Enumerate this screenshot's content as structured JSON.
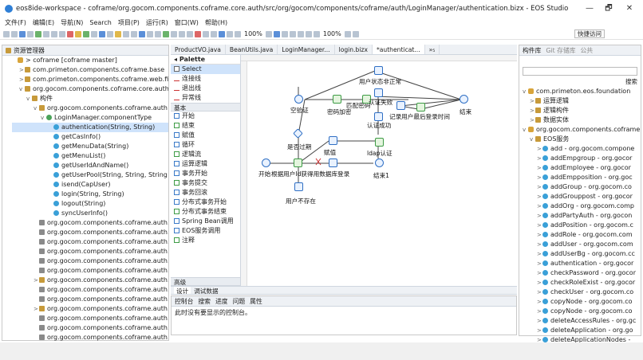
{
  "window": {
    "title": "eos8ide-workspace - coframe/org.gocom.components.coframe.core.auth/src/org/gocom/components/coframe/auth/LoginManager/authentication.bizx - EOS Studio",
    "minimize": "—",
    "maximize": "🗗",
    "close": "✕"
  },
  "menu": [
    "文件(F)",
    "编辑(E)",
    "导航(N)",
    "Search",
    "项目(P)",
    "运行(R)",
    "窗口(W)",
    "帮助(H)"
  ],
  "toolbar": {
    "zoom1": "100%",
    "zoom2": "100%",
    "quick_access": "快捷访问"
  },
  "explorer": {
    "tab": "资源管理器",
    "rows": [
      {
        "indent": 0,
        "tw": "",
        "icon": "prj",
        "text": "> coframe [coframe master]"
      },
      {
        "indent": 1,
        "tw": ">",
        "icon": "pkg",
        "text": "com.primeton.components.coframe.base"
      },
      {
        "indent": 1,
        "tw": ">",
        "icon": "pkg",
        "text": "com.primeton.components.coframe.web.file"
      },
      {
        "indent": 1,
        "tw": "v",
        "icon": "pkg",
        "text": "org.gocom.components.coframe.core.auth"
      },
      {
        "indent": 2,
        "tw": "v",
        "icon": "pkg",
        "text": "构件"
      },
      {
        "indent": 3,
        "tw": "v",
        "icon": "pkg",
        "text": "org.gocom.components.coframe.auth"
      },
      {
        "indent": 4,
        "tw": "v",
        "icon": "cls",
        "text": "LoginManager.componentType"
      },
      {
        "indent": 5,
        "tw": "",
        "icon": "mth",
        "text": "authentication(String, String)",
        "sel": true
      },
      {
        "indent": 5,
        "tw": "",
        "icon": "mth",
        "text": "getCasInfo()"
      },
      {
        "indent": 5,
        "tw": "",
        "icon": "mth",
        "text": "getMenuData(String)"
      },
      {
        "indent": 5,
        "tw": "",
        "icon": "mth",
        "text": "getMenuList()"
      },
      {
        "indent": 5,
        "tw": "",
        "icon": "mth",
        "text": "getUserIdAndName()"
      },
      {
        "indent": 5,
        "tw": "",
        "icon": "mth",
        "text": "getUserPool(String, String, String"
      },
      {
        "indent": 5,
        "tw": "",
        "icon": "mth",
        "text": "isend(CapUser)"
      },
      {
        "indent": 5,
        "tw": "",
        "icon": "mth",
        "text": "login(String, String)"
      },
      {
        "indent": 5,
        "tw": "",
        "icon": "mth",
        "text": "logout(String)"
      },
      {
        "indent": 5,
        "tw": "",
        "icon": "mth",
        "text": "syncUserInfo()"
      },
      {
        "indent": 3,
        "tw": "",
        "icon": "fld",
        "text": "org.gocom.components.coframe.auth.i"
      },
      {
        "indent": 3,
        "tw": "",
        "icon": "fld",
        "text": "org.gocom.components.coframe.auth.i"
      },
      {
        "indent": 3,
        "tw": "",
        "icon": "fld",
        "text": "org.gocom.components.coframe.auth.l"
      },
      {
        "indent": 3,
        "tw": "",
        "icon": "fld",
        "text": "org.gocom.components.coframe.auth.l"
      },
      {
        "indent": 3,
        "tw": "",
        "icon": "fld",
        "text": "org.gocom.components.coframe.auth.l"
      },
      {
        "indent": 3,
        "tw": "",
        "icon": "fld",
        "text": "org.gocom.components.coframe.auth.l"
      },
      {
        "indent": 3,
        "tw": ">",
        "icon": "pkg",
        "text": "org.gocom.components.coframe.auth.p"
      },
      {
        "indent": 3,
        "tw": "",
        "icon": "fld",
        "text": "org.gocom.components.coframe.auth.p"
      },
      {
        "indent": 3,
        "tw": "",
        "icon": "fld",
        "text": "org.gocom.components.coframe.auth.p"
      },
      {
        "indent": 3,
        "tw": ">",
        "icon": "pkg",
        "text": "org.gocom.components.coframe.auth.r"
      },
      {
        "indent": 3,
        "tw": "",
        "icon": "fld",
        "text": "org.gocom.components.coframe.auth.r"
      },
      {
        "indent": 3,
        "tw": "",
        "icon": "fld",
        "text": "org.gocom.components.coframe.auth.s"
      },
      {
        "indent": 3,
        "tw": "",
        "icon": "fld",
        "text": "org.gocom.components.coframe.auth.s"
      }
    ]
  },
  "editor": {
    "tabs": [
      "ProductVO.java",
      "BeanUtils.java",
      "LoginManager...",
      "login.bizx",
      "*authenticat...",
      "»₅"
    ],
    "active_tab": 4,
    "palette": {
      "title": "Palette",
      "select": "Select",
      "links": [
        "连接线",
        "退出线",
        "异常线"
      ],
      "group": "基本",
      "items": [
        "开始",
        "结束",
        "赋值",
        "循环",
        "逻辑流",
        "运算逻辑",
        "事务开始",
        "事务提交",
        "事务回滚",
        "分布式事务开始",
        "分布式事务结束",
        "Spring Bean调用",
        "EOS服务调用",
        "注释"
      ],
      "advanced": "高级"
    },
    "nodes": {
      "n_status": "用户状态非正常",
      "n_empty": "空验证",
      "n_pwd": "密码加密",
      "n_match": "匹配密码",
      "n_authfail": "认证失败",
      "n_record": "记录用户最后登录时间",
      "n_end": "结束",
      "n_authok": "认证成功",
      "n_expired": "是否过期",
      "n_assign": "赋值",
      "n_ldap": "ldap认证",
      "n_start": "开始",
      "n_query": "根据用户Id获得用数据库登录",
      "n_end1": "结束1",
      "n_nouser": "用户不存在"
    },
    "bottom_tabs": [
      "设计",
      "调试数据"
    ]
  },
  "console": {
    "tabs": [
      "控制台",
      "搜索",
      "进度",
      "问题",
      "属性"
    ],
    "message": "此时没有要显示的控制台。"
  },
  "right": {
    "tabs": [
      "构件库",
      "Git 存储库",
      "公共"
    ],
    "search_btn": "搜索",
    "rows": [
      {
        "indent": 0,
        "tw": "v",
        "icon": "prj",
        "text": "com.primeton.eos.foundation"
      },
      {
        "indent": 1,
        "tw": ">",
        "icon": "pkg",
        "text": "运算逻辑"
      },
      {
        "indent": 1,
        "tw": ">",
        "icon": "pkg",
        "text": "逻辑构件"
      },
      {
        "indent": 1,
        "tw": ">",
        "icon": "pkg",
        "text": "数据实体"
      },
      {
        "indent": 0,
        "tw": "v",
        "icon": "prj",
        "text": "org.gocom.components.coframe"
      },
      {
        "indent": 1,
        "tw": "v",
        "icon": "pkg",
        "text": "EOS服务"
      },
      {
        "indent": 2,
        "tw": ">",
        "icon": "mth",
        "text": "add - org.gocom.compone"
      },
      {
        "indent": 2,
        "tw": ">",
        "icon": "mth",
        "text": "addEmpgroup - org.gocor"
      },
      {
        "indent": 2,
        "tw": ">",
        "icon": "mth",
        "text": "addEmployee - org.gocor"
      },
      {
        "indent": 2,
        "tw": ">",
        "icon": "mth",
        "text": "addEmpposition - org.goc"
      },
      {
        "indent": 2,
        "tw": ">",
        "icon": "mth",
        "text": "addGroup - org.gocom.co"
      },
      {
        "indent": 2,
        "tw": ">",
        "icon": "mth",
        "text": "addGrouppost - org.gocor"
      },
      {
        "indent": 2,
        "tw": ">",
        "icon": "mth",
        "text": "addOrg - org.gocom.comp"
      },
      {
        "indent": 2,
        "tw": ">",
        "icon": "mth",
        "text": "addPartyAuth - org.gocon"
      },
      {
        "indent": 2,
        "tw": ">",
        "icon": "mth",
        "text": "addPosition - org.gocom.c"
      },
      {
        "indent": 2,
        "tw": ">",
        "icon": "mth",
        "text": "addRole - org.gocom.com"
      },
      {
        "indent": 2,
        "tw": ">",
        "icon": "mth",
        "text": "addUser - org.gocom.com"
      },
      {
        "indent": 2,
        "tw": ">",
        "icon": "mth",
        "text": "addUserBg - org.gocom.cc"
      },
      {
        "indent": 2,
        "tw": ">",
        "icon": "mth",
        "text": "authentication - org.gocor"
      },
      {
        "indent": 2,
        "tw": ">",
        "icon": "mth",
        "text": "checkPassword - org.gocor"
      },
      {
        "indent": 2,
        "tw": ">",
        "icon": "mth",
        "text": "checkRoleExist - org.gocor"
      },
      {
        "indent": 2,
        "tw": ">",
        "icon": "mth",
        "text": "checkUser - org.gocom.co"
      },
      {
        "indent": 2,
        "tw": ">",
        "icon": "mth",
        "text": "copyNode - org.gocom.co"
      },
      {
        "indent": 2,
        "tw": ">",
        "icon": "mth",
        "text": "copyNode - org.gocom.co"
      },
      {
        "indent": 2,
        "tw": ">",
        "icon": "mth",
        "text": "deleteAccessRules - org.gc"
      },
      {
        "indent": 2,
        "tw": ">",
        "icon": "mth",
        "text": "deleteApplication - org.go"
      },
      {
        "indent": 2,
        "tw": ">",
        "icon": "mth",
        "text": "deleteApplicationNodes -"
      },
      {
        "indent": 2,
        "tw": ">",
        "icon": "mth",
        "text": "deleteApplications - org.g"
      }
    ]
  }
}
